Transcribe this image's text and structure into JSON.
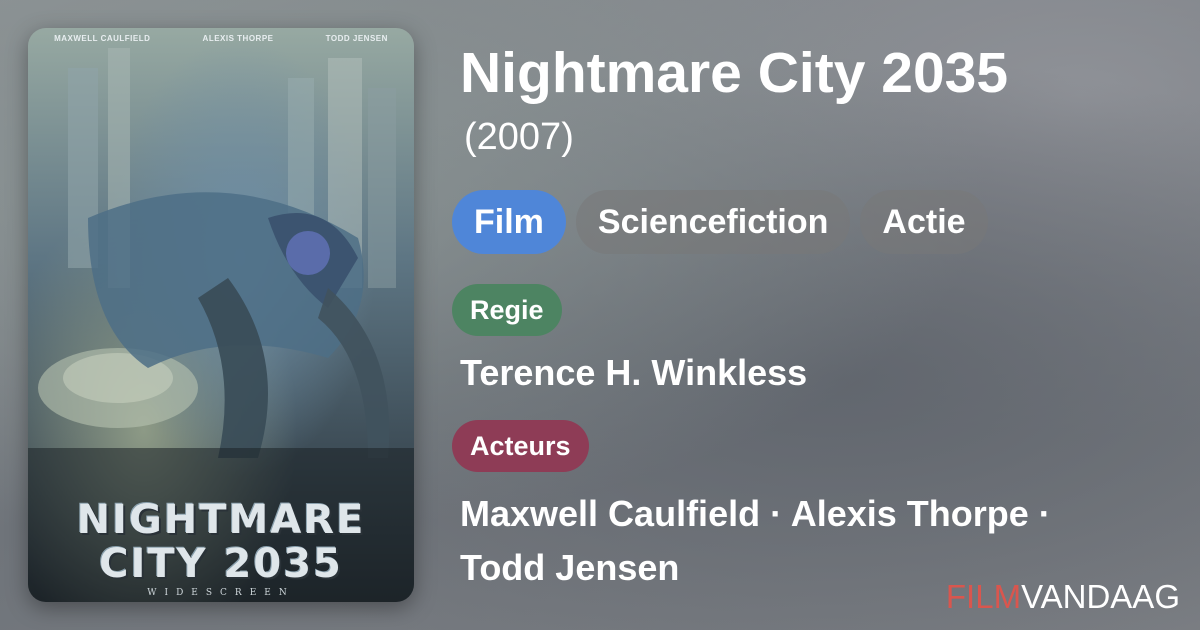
{
  "poster": {
    "actors": [
      "MAXWELL CAULFIELD",
      "ALEXIS THORPE",
      "TODD JENSEN"
    ],
    "title_line1": "NIGHTMARE",
    "title_line2": "CITY 2035",
    "bottom_text": "WIDESCREEN"
  },
  "movie": {
    "title": "Nightmare City 2035",
    "year": "(2007)"
  },
  "genres": [
    "Film",
    "Sciencefiction",
    "Actie"
  ],
  "credits": {
    "director_label": "Regie",
    "director": "Terence H. Winkless",
    "actors_label": "Acteurs",
    "actors_line1": "Maxwell Caulfield · Alexis Thorpe ·",
    "actors_line2": "Todd Jensen"
  },
  "brand": {
    "part1": "FILM",
    "part2": "VANDAAG"
  },
  "colors": {
    "film_chip": "#4f86d8",
    "regie_label": "#4d8462",
    "acteurs_label": "#8e3c56",
    "brand_accent": "#d9564e"
  }
}
